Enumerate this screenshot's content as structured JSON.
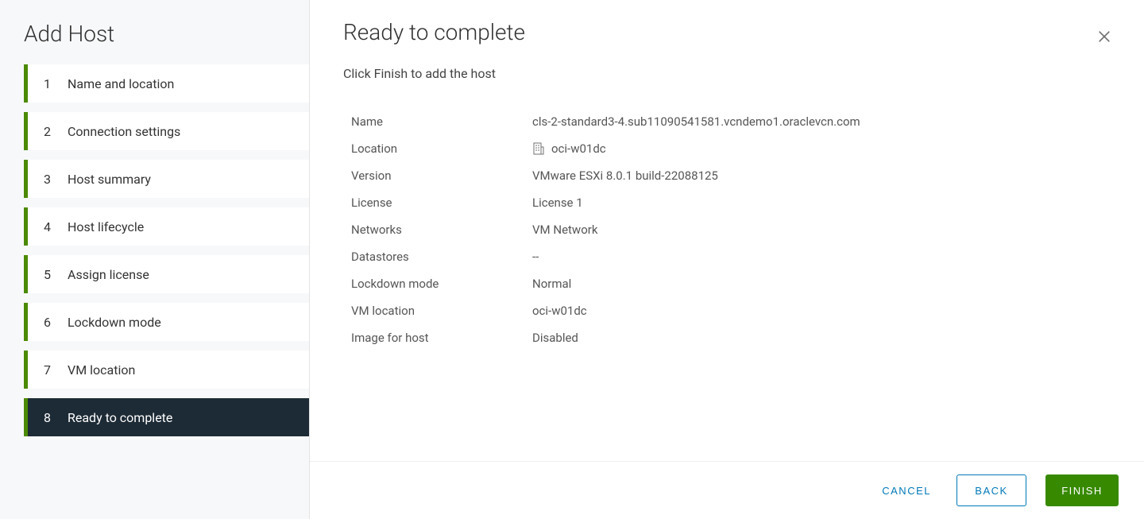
{
  "wizard": {
    "title": "Add Host",
    "steps": [
      {
        "num": "1",
        "label": "Name and location"
      },
      {
        "num": "2",
        "label": "Connection settings"
      },
      {
        "num": "3",
        "label": "Host summary"
      },
      {
        "num": "4",
        "label": "Host lifecycle"
      },
      {
        "num": "5",
        "label": "Assign license"
      },
      {
        "num": "6",
        "label": "Lockdown mode"
      },
      {
        "num": "7",
        "label": "VM location"
      },
      {
        "num": "8",
        "label": "Ready to complete"
      }
    ],
    "activeStep": 7
  },
  "main": {
    "title": "Ready to complete",
    "subtitle": "Click Finish to add the host"
  },
  "summary": {
    "name_label": "Name",
    "name_value": "cls-2-standard3-4.sub11090541581.vcndemo1.oraclevcn.com",
    "location_label": "Location",
    "location_value": "oci-w01dc",
    "version_label": "Version",
    "version_value": "VMware ESXi 8.0.1 build-22088125",
    "license_label": "License",
    "license_value": "License 1",
    "networks_label": "Networks",
    "networks_value": "VM Network",
    "datastores_label": "Datastores",
    "datastores_value": "--",
    "lockdown_label": "Lockdown mode",
    "lockdown_value": "Normal",
    "vmloc_label": "VM location",
    "vmloc_value": "oci-w01dc",
    "image_label": "Image for host",
    "image_value": "Disabled"
  },
  "footer": {
    "cancel": "CANCEL",
    "back": "BACK",
    "finish": "FINISH"
  }
}
